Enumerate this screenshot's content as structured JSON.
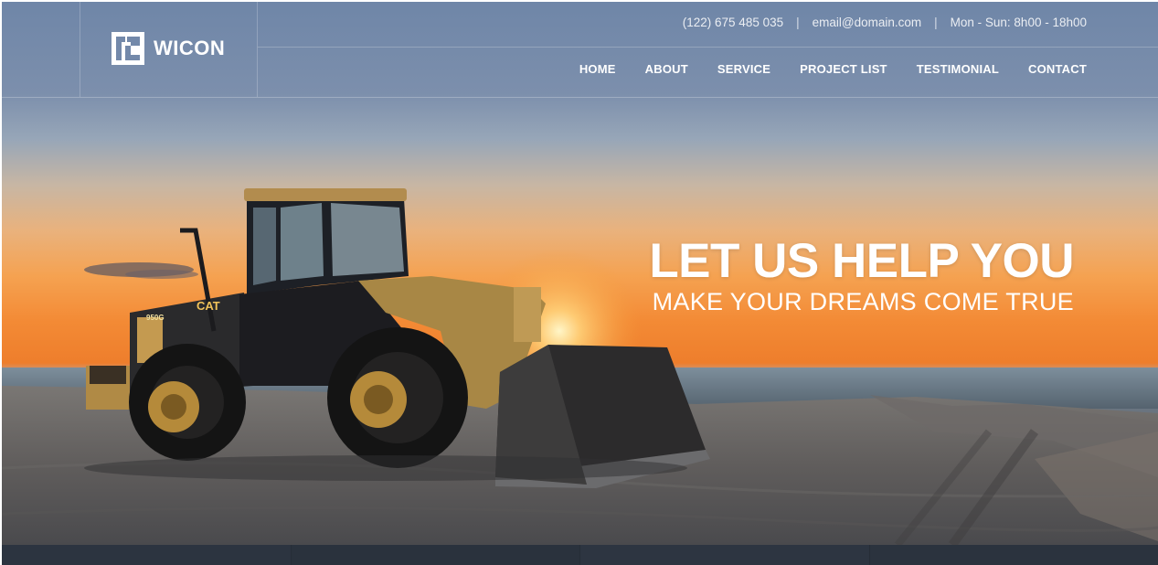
{
  "brand": {
    "name": "WICON"
  },
  "contact": {
    "phone": "(122) 675 485 035",
    "email": "email@domain.com",
    "hours": "Mon - Sun: 8h00 - 18h00",
    "separator": "|"
  },
  "nav": {
    "items": [
      {
        "label": "HOME"
      },
      {
        "label": "ABOUT"
      },
      {
        "label": "SERVICE"
      },
      {
        "label": "PROJECT LIST"
      },
      {
        "label": "TESTIMONIAL"
      },
      {
        "label": "CONTACT"
      }
    ]
  },
  "hero": {
    "title": "LET US HELP YOU",
    "subtitle": "MAKE YOUR DREAMS COME TRUE",
    "image_subject": "wheel-loader-on-beach-at-sunset",
    "vehicle_model_label": "950G",
    "vehicle_brand_label": "CAT"
  },
  "colors": {
    "header_text": "#ffffff",
    "strip": "#2c3440"
  }
}
